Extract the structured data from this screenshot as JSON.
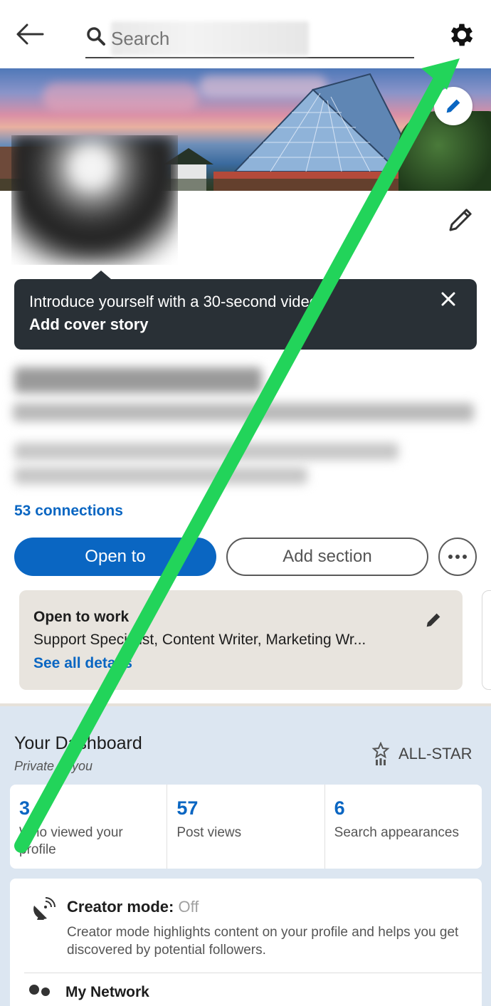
{
  "topbar": {
    "search_placeholder": "Search",
    "search_value": "Cassandra McBride"
  },
  "tooltip": {
    "message": "Introduce yourself with a 30-second video.",
    "cta": "Add cover story"
  },
  "profile": {
    "name": "Cassandra McBride",
    "headline": "Professional Writer at Southern Charm Content Writing",
    "education_line1": "Southern Charm Content Writing · Bryan University",
    "education_line2": "Chattanooga, Tennessee, United States",
    "connections": "53 connections"
  },
  "actions": {
    "open_to": "Open to",
    "add_section": "Add section"
  },
  "open_to_work": {
    "title": "Open to work",
    "roles": "Support Specialist, Content Writer, Marketing Wr...",
    "link": "See all details"
  },
  "dashboard": {
    "title": "Your Dashboard",
    "subtitle": "Private to you",
    "badge": "ALL-STAR",
    "stats": [
      {
        "value": "3",
        "label": "Who viewed your profile"
      },
      {
        "value": "57",
        "label": "Post views"
      },
      {
        "value": "6",
        "label": "Search appearances"
      }
    ],
    "creator_mode": {
      "label": "Creator mode:",
      "status": "Off",
      "description": "Creator mode highlights content on your profile and helps you get discovered by potential followers."
    },
    "my_network": "My Network"
  },
  "colors": {
    "accent": "#0a66c2",
    "annotation_arrow": "#22d45a",
    "tooltip_bg": "#293036",
    "dashboard_bg": "#dce6f1"
  }
}
